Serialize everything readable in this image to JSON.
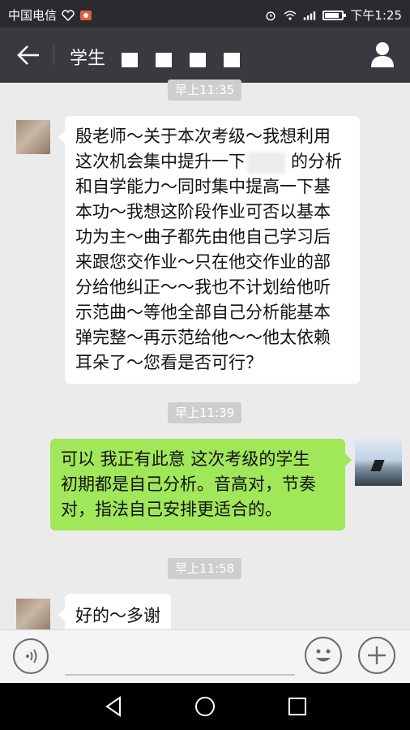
{
  "status_bar": {
    "carrier": "中国电信",
    "time": "下午1:25",
    "battery_level": 0.85
  },
  "header": {
    "title": "学生"
  },
  "messages": [
    {
      "type": "time",
      "text": "早上11:35"
    },
    {
      "type": "incoming",
      "lines": [
        "殷老师～关于本次考级～我想利用",
        "这次机会集中提升一下",
        "和自学能力～同时集中提高一下基",
        "本功～我想这阶段作业可否以基本",
        "功为主～曲子都先由他自己学习后",
        "来跟您交作业～只在他交作业的部",
        "分给他纠正～～我也不计划给他听",
        "示范曲～等他全部自己分析能基本",
        "弹完整～再示范给他～～他太依赖",
        "耳朵了～您看是否可行？"
      ],
      "line2_tail": "的分析"
    },
    {
      "type": "time",
      "text": "早上11:39"
    },
    {
      "type": "outgoing",
      "lines": [
        "可以 我正有此意 这次考级的学生",
        "初期都是自己分析。音高对，节奏",
        "对，指法自己安排更适合的。"
      ]
    },
    {
      "type": "time",
      "text": "早上11:58"
    },
    {
      "type": "incoming",
      "lines": [
        "好的～多谢"
      ]
    }
  ],
  "icons": [
    "back-arrow-icon",
    "person-icon",
    "voice-icon",
    "emoji-icon",
    "plus-icon",
    "nav-back-icon",
    "nav-home-icon",
    "nav-recent-icon"
  ],
  "colors": {
    "titlebar": "#393a3f",
    "outgoing_bubble": "#a0e75a",
    "background": "#ebebeb"
  }
}
